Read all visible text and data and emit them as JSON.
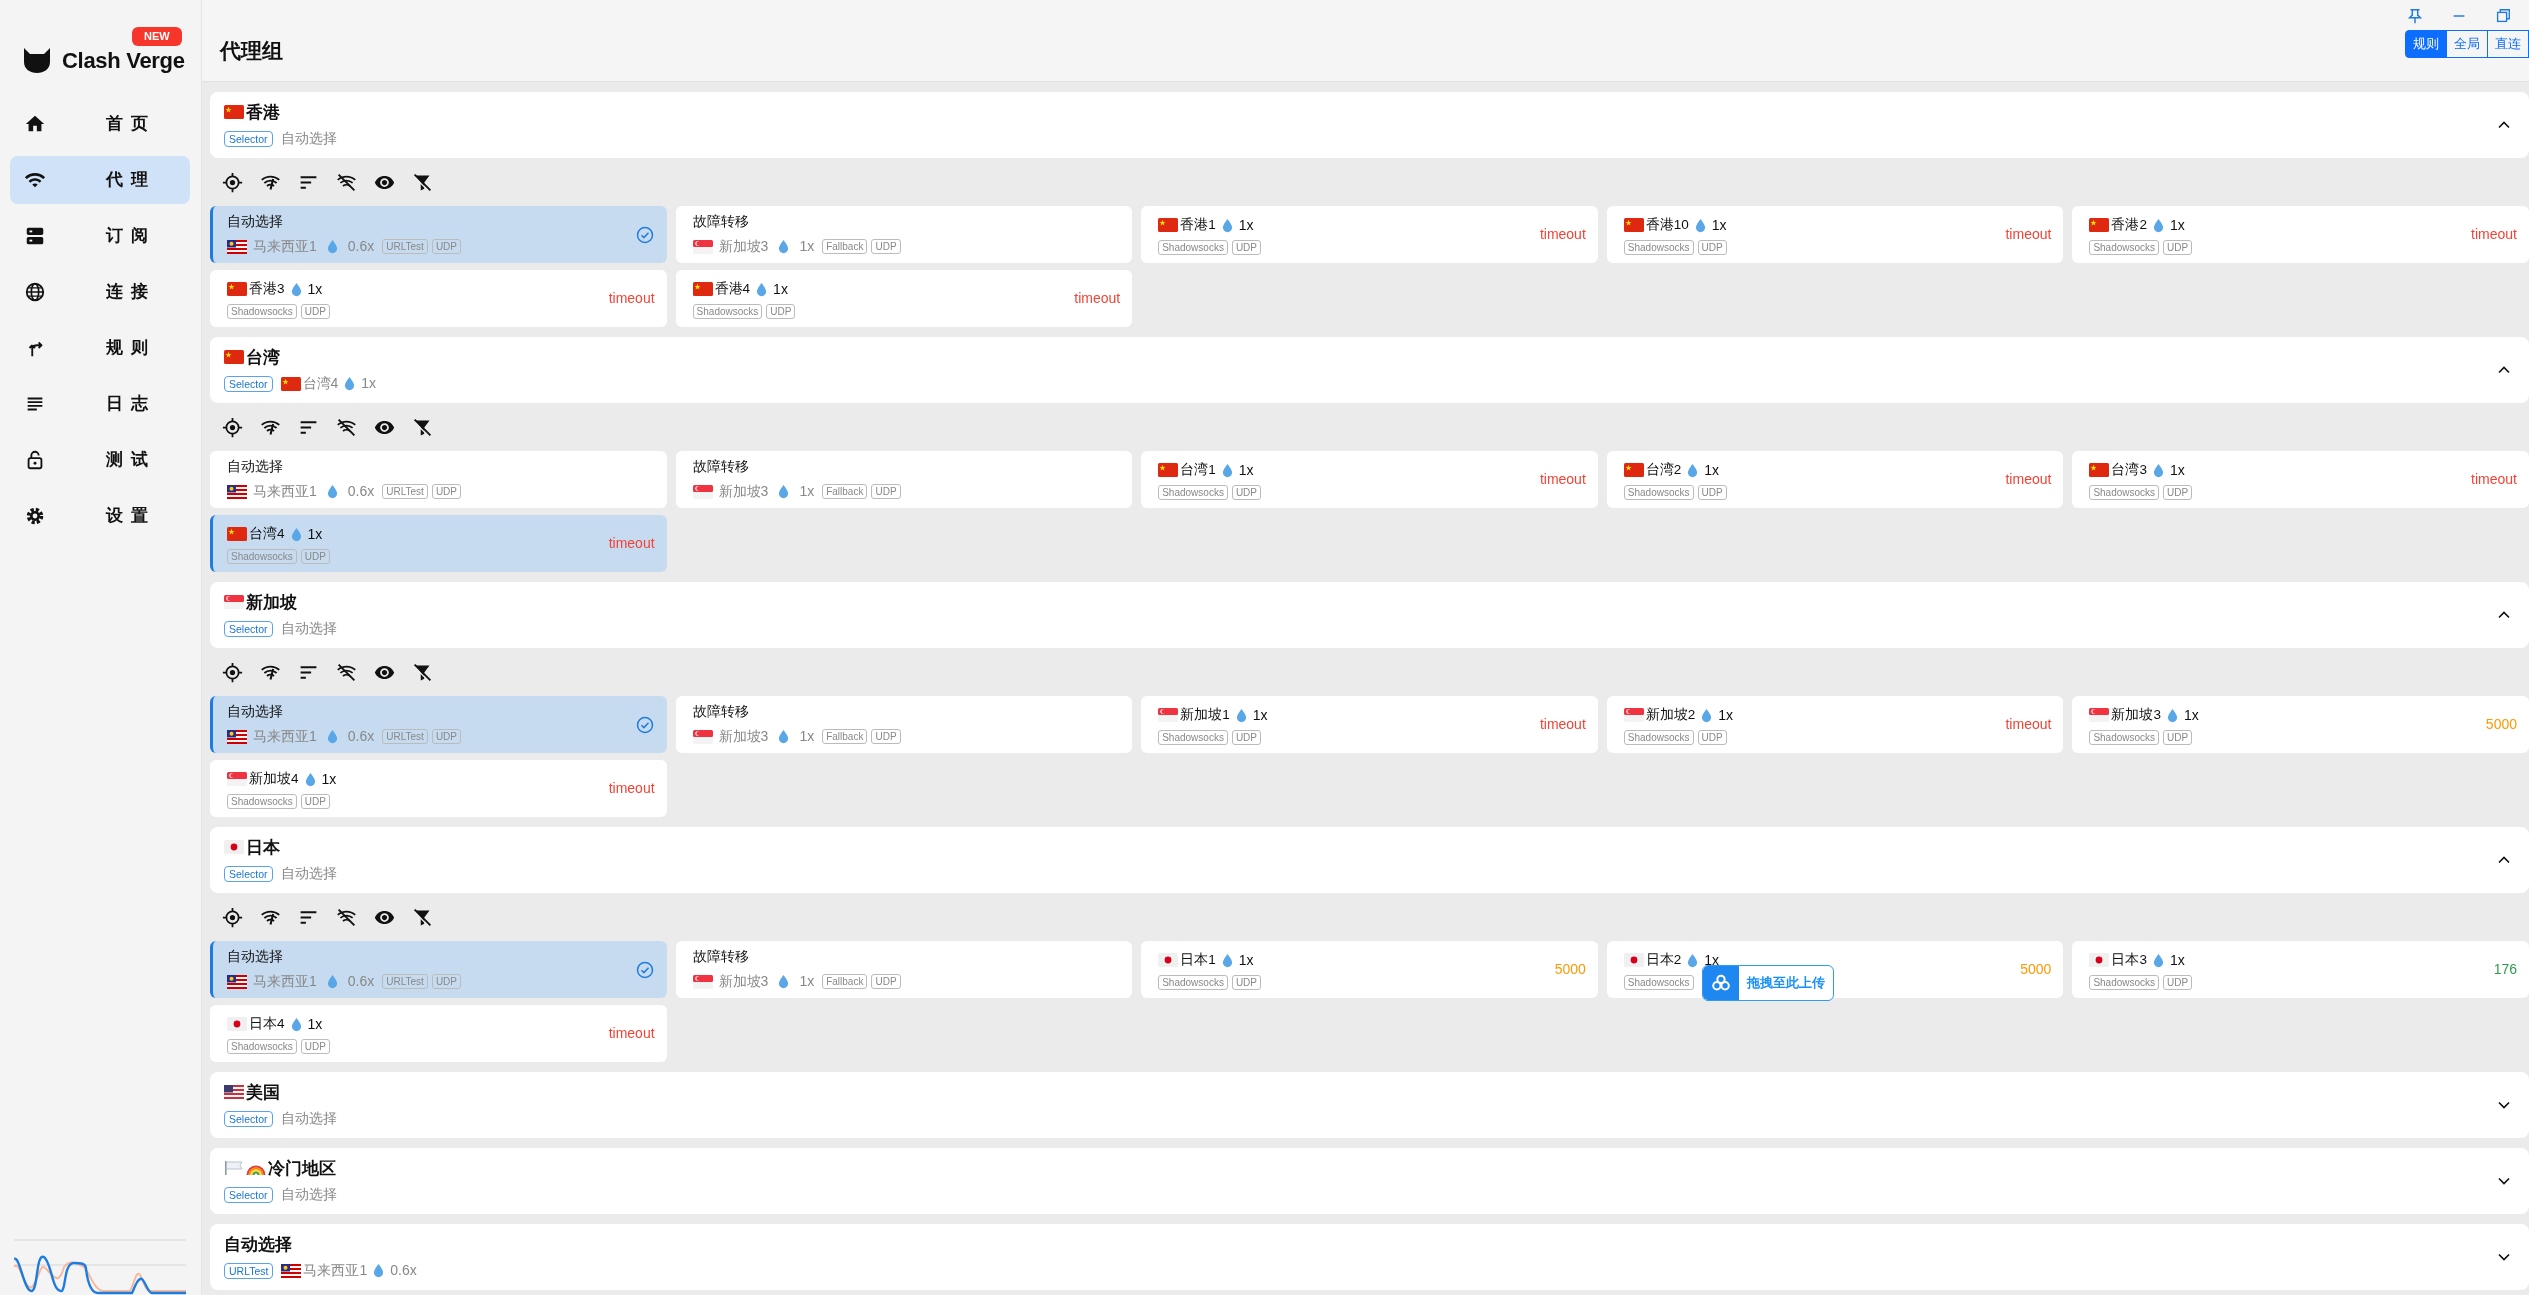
{
  "sidebar": {
    "logo": "Clash Verge",
    "badge": "NEW",
    "items": [
      {
        "label": "首页",
        "selected": false
      },
      {
        "label": "代理",
        "selected": true
      },
      {
        "label": "订阅",
        "selected": false
      },
      {
        "label": "连接",
        "selected": false
      },
      {
        "label": "规则",
        "selected": false
      },
      {
        "label": "日志",
        "selected": false
      },
      {
        "label": "测试",
        "selected": false
      },
      {
        "label": "设置",
        "selected": false
      }
    ]
  },
  "header": {
    "title": "代理组",
    "modes": [
      {
        "label": "规则",
        "selected": true
      },
      {
        "label": "全局",
        "selected": false
      },
      {
        "label": "直连",
        "selected": false
      }
    ]
  },
  "groups": [
    {
      "flags": [
        {
          "kind": "cn"
        }
      ],
      "name": "香港",
      "type": "Selector",
      "now": {
        "name": "自动选择"
      },
      "expanded": true,
      "proxies": [
        {
          "kind": "group",
          "name": "自动选择",
          "sub": {
            "flag": {
              "kind": "my"
            },
            "name": "马来西亚1",
            "speed": "0.6x"
          },
          "tags": [
            "URLTest",
            "UDP"
          ],
          "selected": true
        },
        {
          "kind": "group",
          "name": "故障转移",
          "sub": {
            "flag": {
              "kind": "sg"
            },
            "name": "新加坡3",
            "speed": "1x"
          },
          "tags": [
            "Fallback",
            "UDP"
          ],
          "selected": false
        },
        {
          "kind": "node",
          "flag": {
            "kind": "cn"
          },
          "name": "香港1",
          "speed": "1x",
          "tags": [
            "Shadowsocks",
            "UDP"
          ],
          "delay": "timeout",
          "color": "#f44336",
          "selected": false
        },
        {
          "kind": "node",
          "flag": {
            "kind": "cn"
          },
          "name": "香港10",
          "speed": "1x",
          "tags": [
            "Shadowsocks",
            "UDP"
          ],
          "delay": "timeout",
          "color": "#f44336",
          "selected": false
        },
        {
          "kind": "node",
          "flag": {
            "kind": "cn"
          },
          "name": "香港2",
          "speed": "1x",
          "tags": [
            "Shadowsocks",
            "UDP"
          ],
          "delay": "timeout",
          "color": "#f44336",
          "selected": false
        },
        {
          "kind": "node",
          "flag": {
            "kind": "cn"
          },
          "name": "香港3",
          "speed": "1x",
          "tags": [
            "Shadowsocks",
            "UDP"
          ],
          "delay": "timeout",
          "color": "#f44336",
          "selected": false
        },
        {
          "kind": "node",
          "flag": {
            "kind": "cn"
          },
          "name": "香港4",
          "speed": "1x",
          "tags": [
            "Shadowsocks",
            "UDP"
          ],
          "delay": "timeout",
          "color": "#f44336",
          "selected": false
        }
      ]
    },
    {
      "flags": [
        {
          "kind": "cn"
        }
      ],
      "name": "台湾",
      "type": "Selector",
      "now": {
        "flag": {
          "kind": "cn"
        },
        "name": "台湾4",
        "speed": "1x"
      },
      "expanded": true,
      "proxies": [
        {
          "kind": "group",
          "name": "自动选择",
          "sub": {
            "flag": {
              "kind": "my"
            },
            "name": "马来西亚1",
            "speed": "0.6x"
          },
          "tags": [
            "URLTest",
            "UDP"
          ],
          "selected": false
        },
        {
          "kind": "group",
          "name": "故障转移",
          "sub": {
            "flag": {
              "kind": "sg"
            },
            "name": "新加坡3",
            "speed": "1x"
          },
          "tags": [
            "Fallback",
            "UDP"
          ],
          "selected": false
        },
        {
          "kind": "node",
          "flag": {
            "kind": "cn"
          },
          "name": "台湾1",
          "speed": "1x",
          "tags": [
            "Shadowsocks",
            "UDP"
          ],
          "delay": "timeout",
          "color": "#f44336",
          "selected": false
        },
        {
          "kind": "node",
          "flag": {
            "kind": "cn"
          },
          "name": "台湾2",
          "speed": "1x",
          "tags": [
            "Shadowsocks",
            "UDP"
          ],
          "delay": "timeout",
          "color": "#f44336",
          "selected": false
        },
        {
          "kind": "node",
          "flag": {
            "kind": "cn"
          },
          "name": "台湾3",
          "speed": "1x",
          "tags": [
            "Shadowsocks",
            "UDP"
          ],
          "delay": "timeout",
          "color": "#f44336",
          "selected": false
        },
        {
          "kind": "node",
          "flag": {
            "kind": "cn"
          },
          "name": "台湾4",
          "speed": "1x",
          "tags": [
            "Shadowsocks",
            "UDP"
          ],
          "delay": "timeout",
          "color": "#f44336",
          "selected": true
        }
      ]
    },
    {
      "flags": [
        {
          "kind": "sg"
        }
      ],
      "name": "新加坡",
      "type": "Selector",
      "now": {
        "name": "自动选择"
      },
      "expanded": true,
      "proxies": [
        {
          "kind": "group",
          "name": "自动选择",
          "sub": {
            "flag": {
              "kind": "my"
            },
            "name": "马来西亚1",
            "speed": "0.6x"
          },
          "tags": [
            "URLTest",
            "UDP"
          ],
          "selected": true
        },
        {
          "kind": "group",
          "name": "故障转移",
          "sub": {
            "flag": {
              "kind": "sg"
            },
            "name": "新加坡3",
            "speed": "1x"
          },
          "tags": [
            "Fallback",
            "UDP"
          ],
          "selected": false
        },
        {
          "kind": "node",
          "flag": {
            "kind": "sg"
          },
          "name": "新加坡1",
          "speed": "1x",
          "tags": [
            "Shadowsocks",
            "UDP"
          ],
          "delay": "timeout",
          "color": "#f44336",
          "selected": false
        },
        {
          "kind": "node",
          "flag": {
            "kind": "sg"
          },
          "name": "新加坡2",
          "speed": "1x",
          "tags": [
            "Shadowsocks",
            "UDP"
          ],
          "delay": "timeout",
          "color": "#f44336",
          "selected": false
        },
        {
          "kind": "node",
          "flag": {
            "kind": "sg"
          },
          "name": "新加坡3",
          "speed": "1x",
          "tags": [
            "Shadowsocks",
            "UDP"
          ],
          "delay": "5000",
          "color": "#ff9800",
          "selected": false
        },
        {
          "kind": "node",
          "flag": {
            "kind": "sg"
          },
          "name": "新加坡4",
          "speed": "1x",
          "tags": [
            "Shadowsocks",
            "UDP"
          ],
          "delay": "timeout",
          "color": "#f44336",
          "selected": false
        }
      ]
    },
    {
      "flags": [
        {
          "kind": "jp"
        }
      ],
      "name": "日本",
      "type": "Selector",
      "now": {
        "name": "自动选择"
      },
      "expanded": true,
      "proxies": [
        {
          "kind": "group",
          "name": "自动选择",
          "sub": {
            "flag": {
              "kind": "my"
            },
            "name": "马来西亚1",
            "speed": "0.6x"
          },
          "tags": [
            "URLTest",
            "UDP"
          ],
          "selected": true
        },
        {
          "kind": "group",
          "name": "故障转移",
          "sub": {
            "flag": {
              "kind": "sg"
            },
            "name": "新加坡3",
            "speed": "1x"
          },
          "tags": [
            "Fallback",
            "UDP"
          ],
          "selected": false
        },
        {
          "kind": "node",
          "flag": {
            "kind": "jp"
          },
          "name": "日本1",
          "speed": "1x",
          "tags": [
            "Shadowsocks",
            "UDP"
          ],
          "delay": "5000",
          "color": "#ff9800",
          "selected": false
        },
        {
          "kind": "node",
          "flag": {
            "kind": "jp"
          },
          "name": "日本2",
          "speed": "1x",
          "tags": [
            "Shadowsocks"
          ],
          "delay": "5000",
          "color": "#ff9800",
          "selected": false,
          "upload_hint": "拖拽至此上传"
        },
        {
          "kind": "node",
          "flag": {
            "kind": "jp"
          },
          "name": "日本3",
          "speed": "1x",
          "tags": [
            "Shadowsocks",
            "UDP"
          ],
          "delay": "176",
          "color": "#2e9d4b",
          "selected": false
        },
        {
          "kind": "node",
          "flag": {
            "kind": "jp"
          },
          "name": "日本4",
          "speed": "1x",
          "tags": [
            "Shadowsocks",
            "UDP"
          ],
          "delay": "timeout",
          "color": "#f44336",
          "selected": false
        }
      ]
    },
    {
      "flags": [
        {
          "kind": "us"
        }
      ],
      "name": "美国",
      "type": "Selector",
      "now": {
        "name": "自动选择"
      },
      "expanded": false
    },
    {
      "flags": [
        {
          "kind": "white"
        },
        {
          "kind": "rainbow"
        }
      ],
      "name": "冷门地区",
      "type": "Selector",
      "now": {
        "name": "自动选择"
      },
      "expanded": false
    },
    {
      "name": "自动选择",
      "type": "URLTest",
      "now": {
        "flag": {
          "kind": "my"
        },
        "name": "马来西亚1",
        "speed": "0.6x"
      },
      "expanded": false
    }
  ]
}
